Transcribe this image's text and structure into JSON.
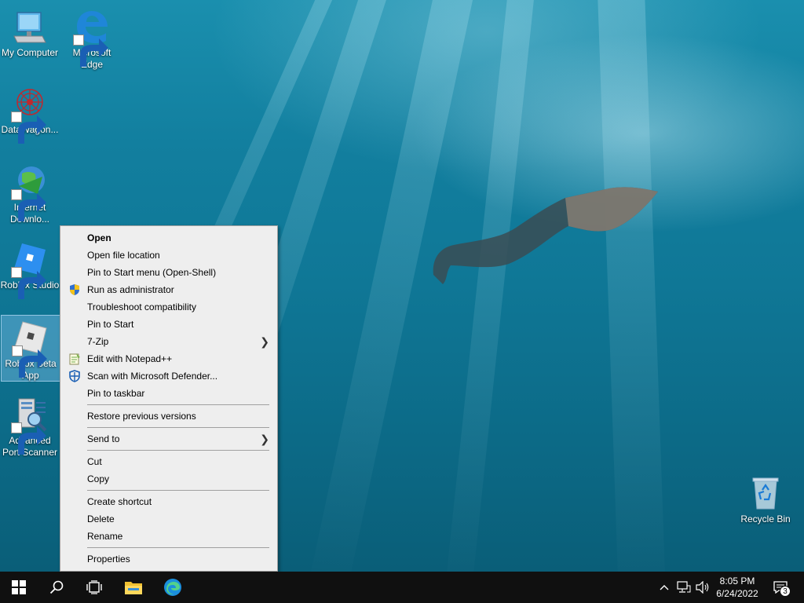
{
  "desktop": {
    "icons": [
      {
        "label": "My Computer"
      },
      {
        "label": "Microsoft Edge"
      },
      {
        "label": "DataWagon..."
      },
      {
        "label": "Internet Downlo..."
      },
      {
        "label": "Roblox Studio"
      },
      {
        "label": "Roblox Beta App"
      },
      {
        "label": "Advanced Port Scanner"
      },
      {
        "label": "Recycle Bin"
      }
    ]
  },
  "context_menu": {
    "items": [
      {
        "label": "Open"
      },
      {
        "label": "Open file location"
      },
      {
        "label": "Pin to Start menu (Open-Shell)"
      },
      {
        "label": "Run as administrator"
      },
      {
        "label": "Troubleshoot compatibility"
      },
      {
        "label": "Pin to Start"
      },
      {
        "label": "7-Zip"
      },
      {
        "label": "Edit with Notepad++"
      },
      {
        "label": "Scan with Microsoft Defender..."
      },
      {
        "label": "Pin to taskbar"
      },
      {
        "label": "Restore previous versions"
      },
      {
        "label": "Send to"
      },
      {
        "label": "Cut"
      },
      {
        "label": "Copy"
      },
      {
        "label": "Create shortcut"
      },
      {
        "label": "Delete"
      },
      {
        "label": "Rename"
      },
      {
        "label": "Properties"
      }
    ]
  },
  "taskbar": {
    "clock": {
      "time": "8:05 PM",
      "date": "6/24/2022"
    },
    "notification_count": "3"
  },
  "colors": {
    "accent": "#0078d7",
    "menu_bg": "#eeeeee",
    "taskbar_bg": "#101010"
  }
}
